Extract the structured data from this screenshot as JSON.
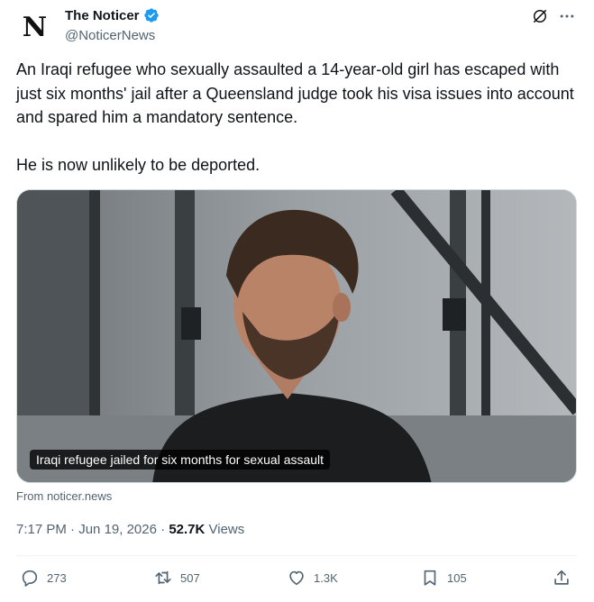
{
  "account": {
    "avatar_letter": "N",
    "display_name": "The Noticer",
    "handle": "@NoticerNews"
  },
  "tweet": {
    "paragraph1": "An Iraqi refugee who sexually assaulted a 14-year-old girl has escaped with just six months' jail after a Queensland judge took his visa issues into account and spared him a mandatory sentence.",
    "paragraph2": "He is now unlikely to be deported."
  },
  "media": {
    "caption": "Iraqi refugee jailed for six months for sexual assault"
  },
  "source": "From noticer.news",
  "meta": {
    "time": "7:17 PM",
    "date": "Jun 19, 2026",
    "views_count": "52.7K",
    "views_label": "Views"
  },
  "actions": {
    "replies": "273",
    "reposts": "507",
    "likes": "1.3K",
    "bookmarks": "105"
  },
  "colors": {
    "text": "#0f1419",
    "secondary": "#536471",
    "verified": "#1d9bf0",
    "divider": "#eff3f4"
  },
  "icons": [
    "verified-badge-icon",
    "grok-icon",
    "more-icon",
    "reply-icon",
    "repost-icon",
    "like-icon",
    "bookmark-icon",
    "share-icon"
  ]
}
